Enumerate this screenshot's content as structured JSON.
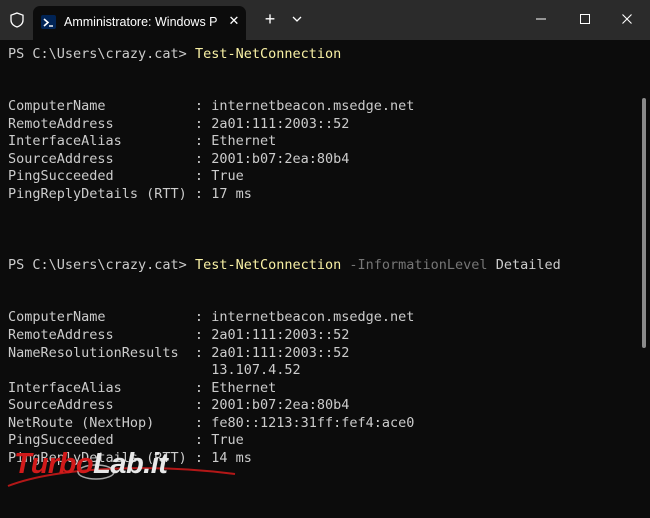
{
  "window": {
    "tab_title": "Amministratore: Windows PowerShell",
    "tab_close": "✕",
    "new_tab": "+",
    "minimize_icon": "minimize-icon",
    "maximize_icon": "maximize-icon",
    "close_icon": "close-icon"
  },
  "terminal": {
    "prompt1": "PS C:\\Users\\crazy.cat> ",
    "cmd1": "Test-NetConnection",
    "out1": [
      "ComputerName           : internetbeacon.msedge.net",
      "RemoteAddress          : 2a01:111:2003::52",
      "InterfaceAlias         : Ethernet",
      "SourceAddress          : 2001:b07:2ea:80b4",
      "PingSucceeded          : True",
      "PingReplyDetails (RTT) : 17 ms"
    ],
    "prompt2": "PS C:\\Users\\crazy.cat> ",
    "cmd2": "Test-NetConnection",
    "cmd2_param": " -InformationLevel",
    "cmd2_value": " Detailed",
    "out2": [
      "ComputerName           : internetbeacon.msedge.net",
      "RemoteAddress          : 2a01:111:2003::52",
      "NameResolutionResults  : 2a01:111:2003::52",
      "                         13.107.4.52",
      "InterfaceAlias         : Ethernet",
      "SourceAddress          : 2001:b07:2ea:80b4",
      "NetRoute (NextHop)     : fe80::1213:31ff:fef4:ace0",
      "PingSucceeded          : True",
      "PingReplyDetails (RTT) : 14 ms"
    ]
  },
  "watermark": {
    "part1": "Turbo",
    "part2": "Lab.it"
  },
  "colors": {
    "background": "#0c0c0c",
    "titlebar": "#2b2b2b",
    "text": "#cccccc",
    "command": "#f9f1a5",
    "parameter": "#767676",
    "watermark_red": "#d11a1a"
  }
}
